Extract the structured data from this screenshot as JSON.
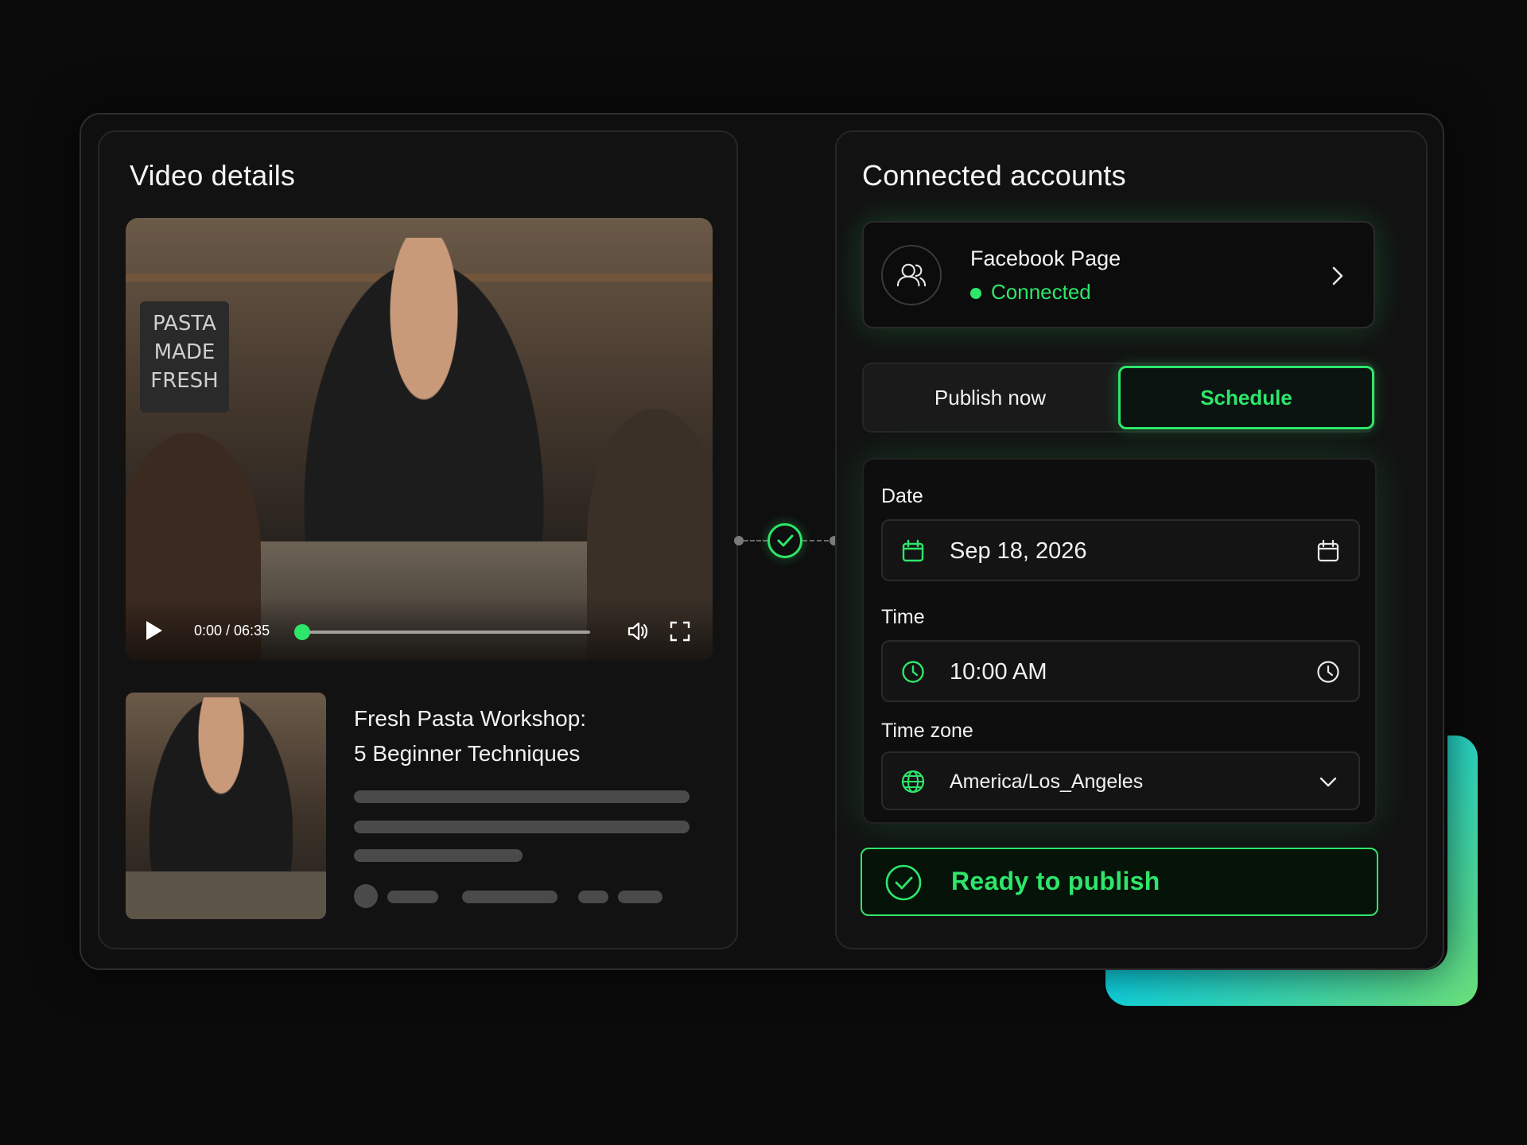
{
  "video_details": {
    "title": "Video details",
    "player": {
      "sign_lines": [
        "PASTA",
        "MADE",
        "FRESH"
      ],
      "time": "0:00 / 06:35",
      "progress": 0
    },
    "card": {
      "title_line1": "Fresh Pasta Workshop:",
      "title_line2": "5 Beginner Techniques"
    }
  },
  "connected_accounts": {
    "title": "Connected accounts",
    "account": {
      "name": "Facebook Page",
      "status": "Connected",
      "icon": "users-icon"
    },
    "publish_mode": {
      "options": [
        "Publish now",
        "Schedule"
      ],
      "selected": "Schedule"
    },
    "schedule": {
      "date_label": "Date",
      "date_value": "Sep 18, 2026",
      "time_label": "Time",
      "time_value": "10:00 AM",
      "timezone_label": "Time zone",
      "timezone_value": "America/Los_Angeles"
    },
    "ready_text": "Ready to publish"
  },
  "colors": {
    "accent": "#2ee66a",
    "background": "#0b0b0b",
    "panel": "#121212"
  }
}
